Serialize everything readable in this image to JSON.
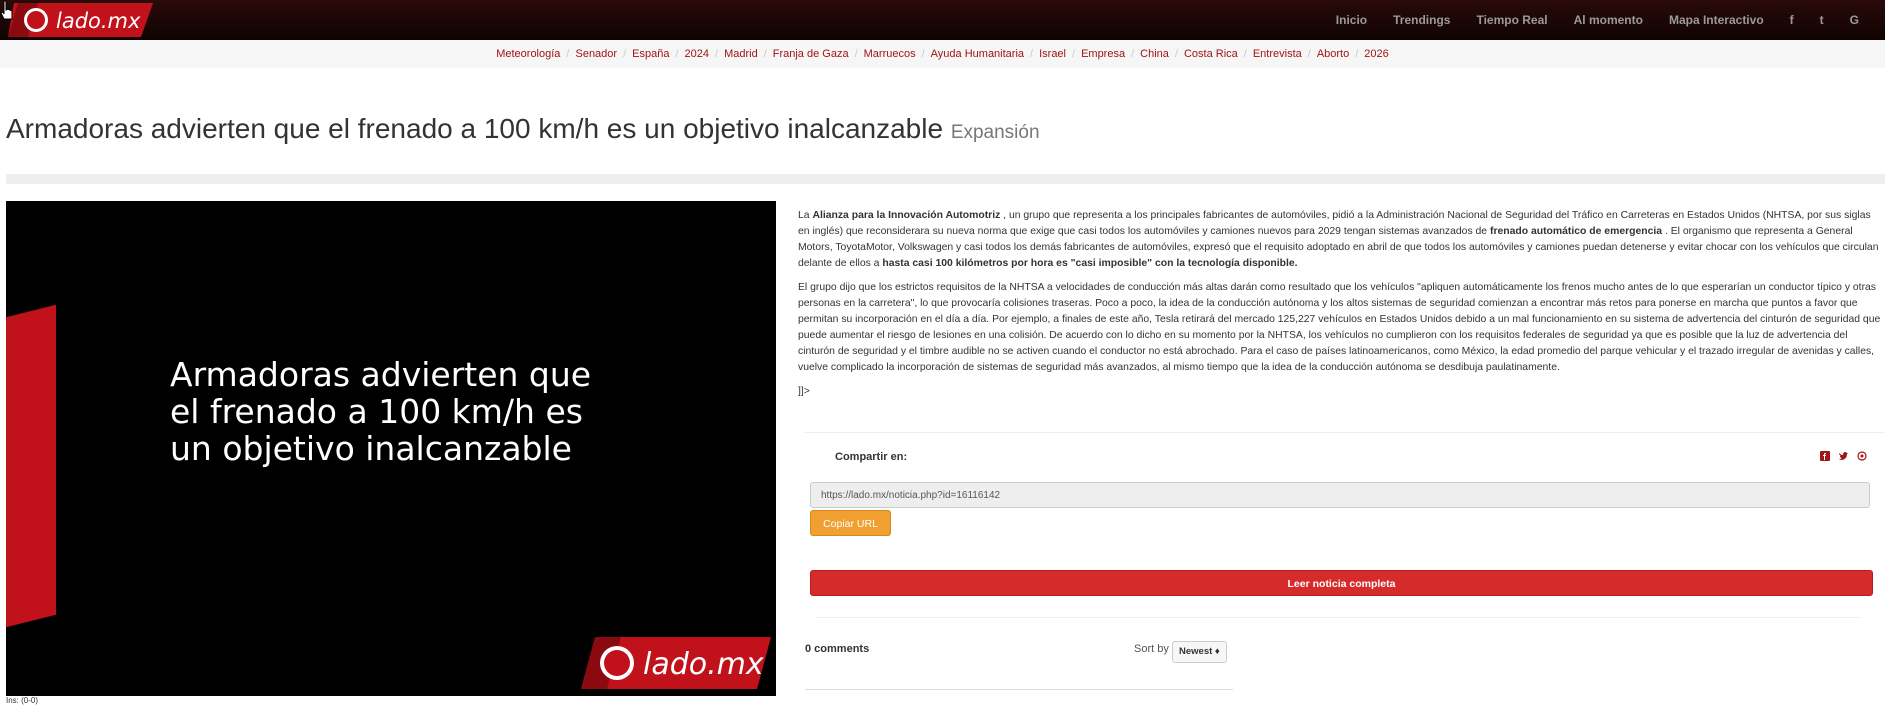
{
  "site": {
    "logo_text": "lado.mx"
  },
  "top_nav": {
    "items": [
      "Inicio",
      "Trendings",
      "Tiempo Real",
      "Al momento",
      "Mapa Interactivo"
    ],
    "social": [
      "f",
      "t",
      "G"
    ]
  },
  "tags": [
    "Meteorología",
    "Senador",
    "España",
    "2024",
    "Madrid",
    "Franja de Gaza",
    "Marruecos",
    "Ayuda Humanitaria",
    "Israel",
    "Empresa",
    "China",
    "Costa Rica",
    "Entrevista",
    "Aborto",
    "2026"
  ],
  "article": {
    "title": "Armadoras advierten que el frenado a 100 km/h es un objetivo inalcanzable",
    "source": "Expansión",
    "image_caption": "Armadoras advierten que el frenado a 100 km/h es un objetivo inalcanzable",
    "p1": [
      {
        "t": "La ",
        "b": false
      },
      {
        "t": "Alianza para la Innovación Automotriz",
        "b": true
      },
      {
        "t": " , un grupo que representa a los principales fabricantes de automóviles, pidió a la Administración Nacional de Seguridad del Tráfico en Carreteras en Estados Unidos (NHTSA, por sus siglas en inglés) que reconsiderara su nueva norma que exige que casi todos los automóviles y camiones nuevos para 2029 tengan sistemas avanzados de ",
        "b": false
      },
      {
        "t": "frenado automático de emergencia",
        "b": true
      },
      {
        "t": " . El organismo que representa a General Motors, ToyotaMotor, Volkswagen y casi todos los demás fabricantes de automóviles, expresó que el requisito adoptado en abril de que todos los automóviles y camiones puedan detenerse y evitar chocar con los vehículos que circulan delante de ellos a ",
        "b": false
      },
      {
        "t": "hasta casi 100 kilómetros por hora es \"casi imposible\" con la tecnología disponible.",
        "b": true
      }
    ],
    "p2": "El grupo dijo que los estrictos requisitos de la NHTSA a velocidades de conducción más altas darán como resultado que los vehículos \"apliquen automáticamente los frenos mucho antes de lo que esperarían un conductor típico y otras personas en la carretera\", lo que provocaría colisiones traseras. Poco a poco, la idea de la conducción autónoma y los altos sistemas de seguridad comienzan a encontrar más retos para ponerse en marcha que puntos a favor que permitan su incorporación en el día a día. Por ejemplo, a finales de este año, Tesla retirará del mercado 125,227 vehículos en Estados Unidos debido a un mal funcionamiento en su sistema de advertencia del cinturón de seguridad que puede aumentar el riesgo de lesiones en una colisión. De acuerdo con lo dicho en su momento por la NHTSA, los vehículos no cumplieron con los requisitos federales de seguridad ya que es posible que la luz de advertencia del cinturón de seguridad y el timbre audible no se activen cuando el conductor no está abrochado. Para el caso de países latinoamericanos, como México, la edad promedio del parque vehicular y el trazado irregular de avenidas y calles, vuelve complicado la incorporación de sistemas de seguridad más avanzados, al mismo tiempo que la idea de la conducción autónoma se desdibuja paulatinamente.",
    "p3": "]]>"
  },
  "share": {
    "label": "Compartir en:",
    "icons": [
      "facebook-icon",
      "twitter-icon",
      "whatsapp-icon"
    ],
    "url": "https://lado.mx/noticia.php?id=16116142",
    "copy_label": "Copiar URL",
    "read_label": "Leer noticia completa"
  },
  "comments": {
    "count_label": "0 comments",
    "sort_label": "Sort by",
    "sort_value": "Newest ♦"
  },
  "credit": "Ins: (0-0)"
}
